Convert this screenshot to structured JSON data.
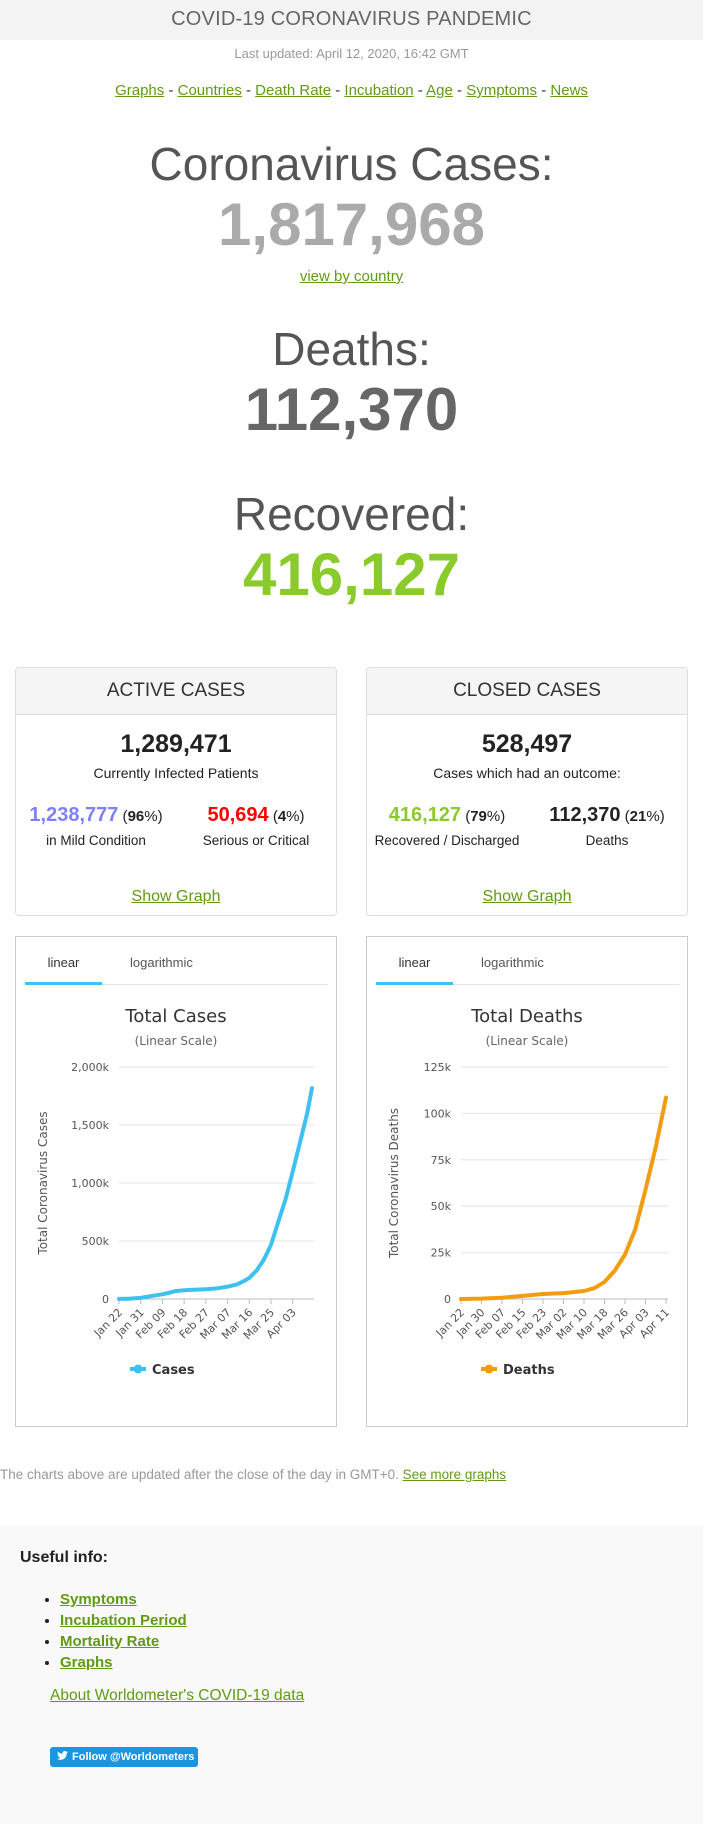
{
  "header": {
    "title": "COVID-19 CORONAVIRUS PANDEMIC"
  },
  "last_updated": "Last updated: April 12, 2020, 16:42 GMT",
  "nav": [
    "Graphs",
    "Countries",
    "Death Rate",
    "Incubation",
    "Age",
    "Symptoms",
    "News"
  ],
  "nav_separator": " - ",
  "stats": {
    "cases_label": "Coronavirus Cases:",
    "cases_value": "1,817,968",
    "view_by_country": "view by country",
    "deaths_label": "Deaths:",
    "deaths_value": "112,370",
    "recovered_label": "Recovered:",
    "recovered_value": "416,127"
  },
  "active_cases": {
    "heading": "ACTIVE CASES",
    "total": "1,289,471",
    "total_label": "Currently Infected Patients",
    "mild_value": "1,238,777",
    "mild_pct_open": " (",
    "mild_pct": "96",
    "mild_pct_close": "%)",
    "mild_label": "in Mild Condition",
    "serious_value": "50,694",
    "serious_pct_open": " (",
    "serious_pct": "4",
    "serious_pct_close": "%)",
    "serious_label": "Serious or Critical",
    "show_graph": "Show Graph"
  },
  "closed_cases": {
    "heading": "CLOSED CASES",
    "total": "528,497",
    "total_label": "Cases which had an outcome:",
    "recovered_value": "416,127",
    "recovered_pct_open": " (",
    "recovered_pct": "79",
    "recovered_pct_close": "%)",
    "recovered_label": "Recovered / Discharged",
    "deaths_value": "112,370",
    "deaths_pct_open": " (",
    "deaths_pct": "21",
    "deaths_pct_close": "%)",
    "deaths_label": "Deaths",
    "show_graph": "Show Graph"
  },
  "chart_tabs": {
    "linear": "linear",
    "log": "logarithmic"
  },
  "colors": {
    "cases": "#3ec1f0",
    "deaths": "#f39c12",
    "recovered": "#8ACA2B",
    "mild": "#8080FF",
    "serious": "#FF0000",
    "link": "#609b13"
  },
  "chart_data": [
    {
      "type": "line",
      "title": "Total Cases",
      "subtitle": "(Linear Scale)",
      "ylabel": "Total Coronavirus Cases",
      "xlabel": "",
      "ylim": [
        0,
        2000000
      ],
      "yticks": [
        0,
        500000,
        1000000,
        1500000,
        2000000
      ],
      "ytick_labels": [
        "0",
        "500k",
        "1,000k",
        "1,500k",
        "2,000k"
      ],
      "xtick_labels": [
        "Jan 22",
        "Jan 31",
        "Feb 09",
        "Feb 18",
        "Feb 27",
        "Mar 07",
        "Mar 16",
        "Mar 25",
        "Apr 03"
      ],
      "series": [
        {
          "name": "Cases",
          "x": [
            "Jan 22",
            "Jan 26",
            "Jan 31",
            "Feb 04",
            "Feb 09",
            "Feb 13",
            "Feb 14",
            "Feb 18",
            "Feb 22",
            "Feb 27",
            "Mar 03",
            "Mar 07",
            "Mar 11",
            "Mar 14",
            "Mar 16",
            "Mar 19",
            "Mar 22",
            "Mar 25",
            "Mar 28",
            "Mar 31",
            "Apr 03",
            "Apr 06",
            "Apr 09",
            "Apr 11"
          ],
          "values": [
            580,
            2900,
            9900,
            24500,
            40500,
            60000,
            67000,
            75000,
            78900,
            84000,
            92800,
            105800,
            126500,
            156800,
            182000,
            245000,
            337000,
            467000,
            664000,
            858000,
            1098000,
            1346000,
            1603000,
            1817968
          ]
        }
      ]
    },
    {
      "type": "line",
      "title": "Total Deaths",
      "subtitle": "(Linear Scale)",
      "ylabel": "Total Coronavirus Deaths",
      "xlabel": "",
      "ylim": [
        0,
        125000
      ],
      "yticks": [
        0,
        25000,
        50000,
        75000,
        100000,
        125000
      ],
      "ytick_labels": [
        "0",
        "25k",
        "50k",
        "75k",
        "100k",
        "125k"
      ],
      "xtick_labels": [
        "Jan 22",
        "Jan 30",
        "Feb 07",
        "Feb 15",
        "Feb 23",
        "Mar 02",
        "Mar 10",
        "Mar 18",
        "Mar 26",
        "Apr 03",
        "Apr 11"
      ],
      "series": [
        {
          "name": "Deaths",
          "x": [
            "Jan 22",
            "Jan 30",
            "Feb 07",
            "Feb 15",
            "Feb 23",
            "Mar 02",
            "Mar 10",
            "Mar 14",
            "Mar 18",
            "Mar 22",
            "Mar 26",
            "Mar 30",
            "Apr 03",
            "Apr 07",
            "Apr 11"
          ],
          "values": [
            17,
            213,
            724,
            1670,
            2700,
            3200,
            4300,
            5800,
            9200,
            15300,
            24000,
            37600,
            58900,
            82000,
            108500
          ]
        }
      ]
    }
  ],
  "footer": {
    "charts_note": "The charts above are updated after the close of the day in GMT+0. ",
    "see_more": "See more graphs",
    "useful_heading": "Useful info:",
    "useful_links": [
      "Symptoms",
      "Incubation Period",
      "Mortality Rate",
      "Graphs"
    ],
    "about": "About Worldometer's COVID-19 data",
    "twitter": "Follow @Worldometers"
  }
}
